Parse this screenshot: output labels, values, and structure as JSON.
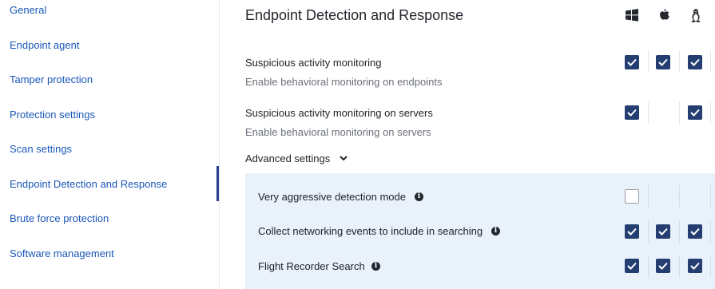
{
  "sidebar": {
    "items": [
      {
        "label": "General"
      },
      {
        "label": "Endpoint agent"
      },
      {
        "label": "Tamper protection"
      },
      {
        "label": "Protection settings"
      },
      {
        "label": "Scan settings"
      },
      {
        "label": "Endpoint Detection and Response",
        "active": true
      },
      {
        "label": "Brute force protection"
      },
      {
        "label": "Software management"
      }
    ]
  },
  "main": {
    "title": "Endpoint Detection and Response",
    "os_columns": [
      "windows-icon",
      "apple-icon",
      "linux-icon"
    ],
    "settings": [
      {
        "label": "Suspicious activity monitoring",
        "description": "Enable behavioral monitoring on endpoints",
        "windows": true,
        "mac": true,
        "linux": true
      },
      {
        "label": "Suspicious activity monitoring on servers",
        "description": "Enable behavioral monitoring on servers",
        "windows": true,
        "mac": null,
        "linux": true
      }
    ],
    "advanced": {
      "label": "Advanced settings",
      "items": [
        {
          "label": "Very aggressive detection mode",
          "windows": false,
          "mac": null,
          "linux": null
        },
        {
          "label": "Collect networking events to include in searching",
          "windows": true,
          "mac": true,
          "linux": true
        },
        {
          "label": "Flight Recorder Search",
          "windows": true,
          "mac": true,
          "linux": true
        }
      ]
    }
  },
  "colors": {
    "link": "#1a57b8",
    "active_bar": "#2b3f8c",
    "checkbox_checked": "#243e72",
    "advanced_panel": "#e9f1fb"
  }
}
